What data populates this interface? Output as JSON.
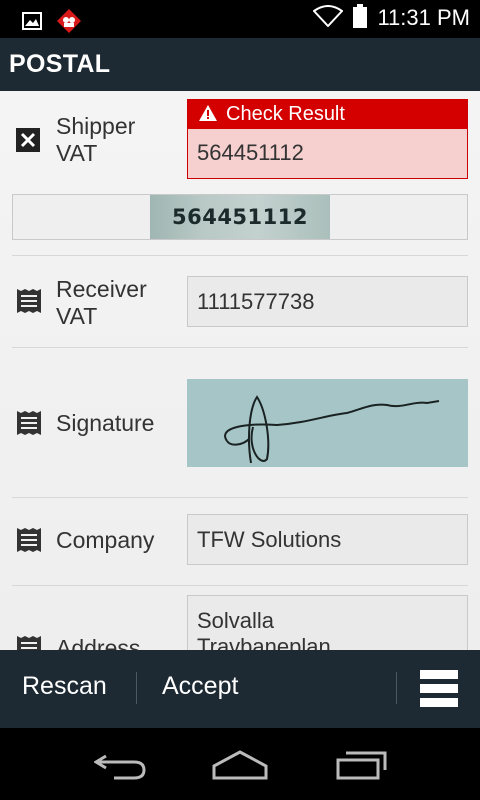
{
  "status_bar": {
    "time": "11:31 PM",
    "left_icons": [
      "image-icon",
      "app-notification-icon"
    ],
    "right_icons": [
      "wifi-icon",
      "battery-icon"
    ]
  },
  "app_bar": {
    "title": "POSTAL"
  },
  "fields": [
    {
      "label_line1": "Shipper",
      "label_line2": "VAT",
      "status_icon": "error-x-icon",
      "value": "564451112",
      "error": {
        "title": "Check Result",
        "icon": "warning-icon"
      },
      "scan_snippet_text": "564451112"
    },
    {
      "label_line1": "Receiver",
      "label_line2": "VAT",
      "status_icon": "document-icon",
      "value": "1111577738"
    },
    {
      "label": "Signature",
      "status_icon": "document-icon",
      "value_type": "signature-image"
    },
    {
      "label": "Company",
      "status_icon": "document-icon",
      "value": "TFW Solutions"
    },
    {
      "label": "Address",
      "status_icon": "document-icon",
      "value_line1": "Solvalla",
      "value_line2": "Travbaneplan"
    }
  ],
  "bottom_bar": {
    "rescan_label": "Rescan",
    "accept_label": "Accept",
    "menu_icon": "menu-icon"
  },
  "nav_bar": {
    "icons": [
      "back-icon",
      "home-icon",
      "recent-apps-icon"
    ]
  },
  "colors": {
    "app_bar": "#1d2a33",
    "error_red": "#d40000",
    "error_bg": "#f6cfcf",
    "content_bg": "#f2f2f2"
  }
}
